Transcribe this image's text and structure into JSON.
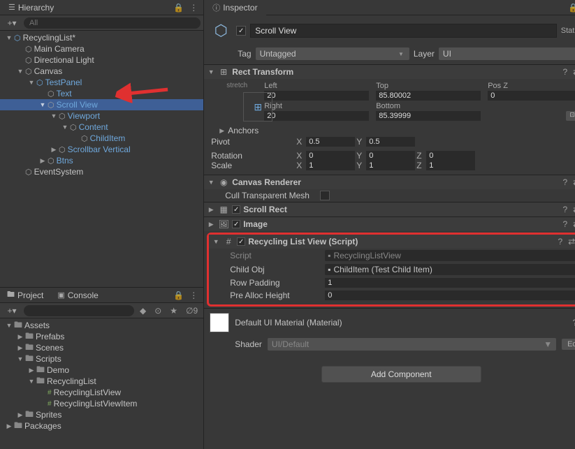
{
  "hierarchy": {
    "tab_label": "Hierarchy",
    "search_placeholder": "All",
    "items": [
      {
        "indent": 0,
        "arrow": "down",
        "icon": "prefab",
        "label": "RecyclingList",
        "modified": true,
        "menu": true
      },
      {
        "indent": 1,
        "arrow": "none",
        "icon": "cube",
        "label": "Main Camera"
      },
      {
        "indent": 1,
        "arrow": "none",
        "icon": "cube",
        "label": "Directional Light"
      },
      {
        "indent": 1,
        "arrow": "down",
        "icon": "cube",
        "label": "Canvas"
      },
      {
        "indent": 2,
        "arrow": "down",
        "icon": "prefab",
        "label": "TestPanel",
        "link": true
      },
      {
        "indent": 3,
        "arrow": "none",
        "icon": "cube",
        "label": "Text",
        "link": true
      },
      {
        "indent": 3,
        "arrow": "down",
        "icon": "cube",
        "label": "Scroll View",
        "link": true,
        "selected": true
      },
      {
        "indent": 4,
        "arrow": "down",
        "icon": "cube",
        "label": "Viewport",
        "link": true
      },
      {
        "indent": 5,
        "arrow": "down",
        "icon": "cube",
        "label": "Content",
        "link": true
      },
      {
        "indent": 6,
        "arrow": "none",
        "icon": "cube",
        "label": "ChildItem",
        "link": true
      },
      {
        "indent": 4,
        "arrow": "right",
        "icon": "cube",
        "label": "Scrollbar Vertical",
        "link": true
      },
      {
        "indent": 3,
        "arrow": "right",
        "icon": "cube",
        "label": "Btns",
        "link": true
      },
      {
        "indent": 1,
        "arrow": "none",
        "icon": "cube",
        "label": "EventSystem"
      }
    ]
  },
  "project": {
    "tab_label": "Project",
    "console_label": "Console",
    "eye_count": "9",
    "items": [
      {
        "indent": 0,
        "arrow": "down",
        "icon": "folder",
        "label": "Assets"
      },
      {
        "indent": 1,
        "arrow": "right",
        "icon": "folder",
        "label": "Prefabs"
      },
      {
        "indent": 1,
        "arrow": "right",
        "icon": "folder",
        "label": "Scenes"
      },
      {
        "indent": 1,
        "arrow": "down",
        "icon": "folder",
        "label": "Scripts"
      },
      {
        "indent": 2,
        "arrow": "right",
        "icon": "folder",
        "label": "Demo"
      },
      {
        "indent": 2,
        "arrow": "down",
        "icon": "folder",
        "label": "RecyclingList"
      },
      {
        "indent": 3,
        "arrow": "none",
        "icon": "script",
        "label": "RecyclingListView"
      },
      {
        "indent": 3,
        "arrow": "none",
        "icon": "script",
        "label": "RecyclingListViewItem"
      },
      {
        "indent": 1,
        "arrow": "right",
        "icon": "folder",
        "label": "Sprites"
      },
      {
        "indent": 0,
        "arrow": "right",
        "icon": "folder",
        "label": "Packages"
      }
    ]
  },
  "inspector": {
    "tab_label": "Inspector",
    "object_name": "Scroll View",
    "static_label": "Static",
    "tag_label": "Tag",
    "tag_value": "Untagged",
    "layer_label": "Layer",
    "layer_value": "UI",
    "rect_transform": {
      "title": "Rect Transform",
      "stretch_label": "stretch",
      "left_label": "Left",
      "left_val": "20",
      "top_label": "Top",
      "top_val": "85.80002",
      "posz_label": "Pos Z",
      "posz_val": "0",
      "right_label": "Right",
      "right_val": "20",
      "bottom_label": "Bottom",
      "bottom_val": "85.39999",
      "anchors_label": "Anchors",
      "pivot_label": "Pivot",
      "pivot_x": "0.5",
      "pivot_y": "0.5",
      "rotation_label": "Rotation",
      "rot_x": "0",
      "rot_y": "0",
      "rot_z": "0",
      "scale_label": "Scale",
      "scale_x": "1",
      "scale_y": "1",
      "scale_z": "1",
      "btn_r": "R"
    },
    "canvas_renderer": {
      "title": "Canvas Renderer",
      "cull_label": "Cull Transparent Mesh"
    },
    "scroll_rect_title": "Scroll Rect",
    "image_title": "Image",
    "recycling": {
      "title": "Recycling List View (Script)",
      "script_label": "Script",
      "script_val": "RecyclingListView",
      "childobj_label": "Child Obj",
      "childobj_val": "ChildItem (Test Child Item)",
      "rowpad_label": "Row Padding",
      "rowpad_val": "1",
      "prealloc_label": "Pre Alloc Height",
      "prealloc_val": "0"
    },
    "material": {
      "title": "Default UI Material (Material)",
      "shader_label": "Shader",
      "shader_val": "UI/Default",
      "edit_label": "Edit..."
    },
    "add_component": "Add Component"
  }
}
